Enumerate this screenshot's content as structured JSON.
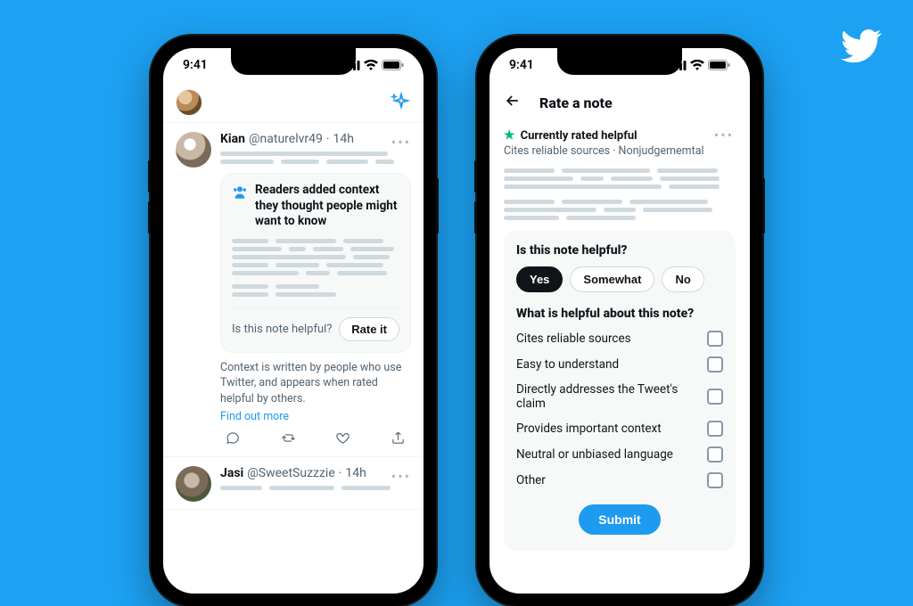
{
  "brand": {
    "color": "#1DA1F2"
  },
  "status": {
    "time": "9:41"
  },
  "phone1": {
    "tweet1": {
      "displayName": "Kian",
      "handle": "@naturelvr49",
      "time": "14h"
    },
    "contextCard": {
      "title": "Readers added context they thought people might want to know",
      "question": "Is this note helpful?",
      "rateLabel": "Rate it",
      "footer": "Context is written by people who use Twitter, and appears when rated helpful by others.",
      "findMore": "Find out more"
    },
    "tweet2": {
      "displayName": "Jasi",
      "handle": "@SweetSuzzzie",
      "time": "14h"
    }
  },
  "phone2": {
    "title": "Rate a note",
    "ratedTag": "Currently rated helpful",
    "ratedSub": "Cites reliable sources · Nonjudgememtal",
    "q1": "Is this note helpful?",
    "options": {
      "yes": "Yes",
      "somewhat": "Somewhat",
      "no": "No"
    },
    "q2": "What is helpful about this note?",
    "checks": {
      "c1": "Cites reliable sources",
      "c2": "Easy to understand",
      "c3": "Directly addresses the Tweet's claim",
      "c4": "Provides important context",
      "c5": "Neutral or unbiased language",
      "c6": "Other"
    },
    "submit": "Submit"
  }
}
